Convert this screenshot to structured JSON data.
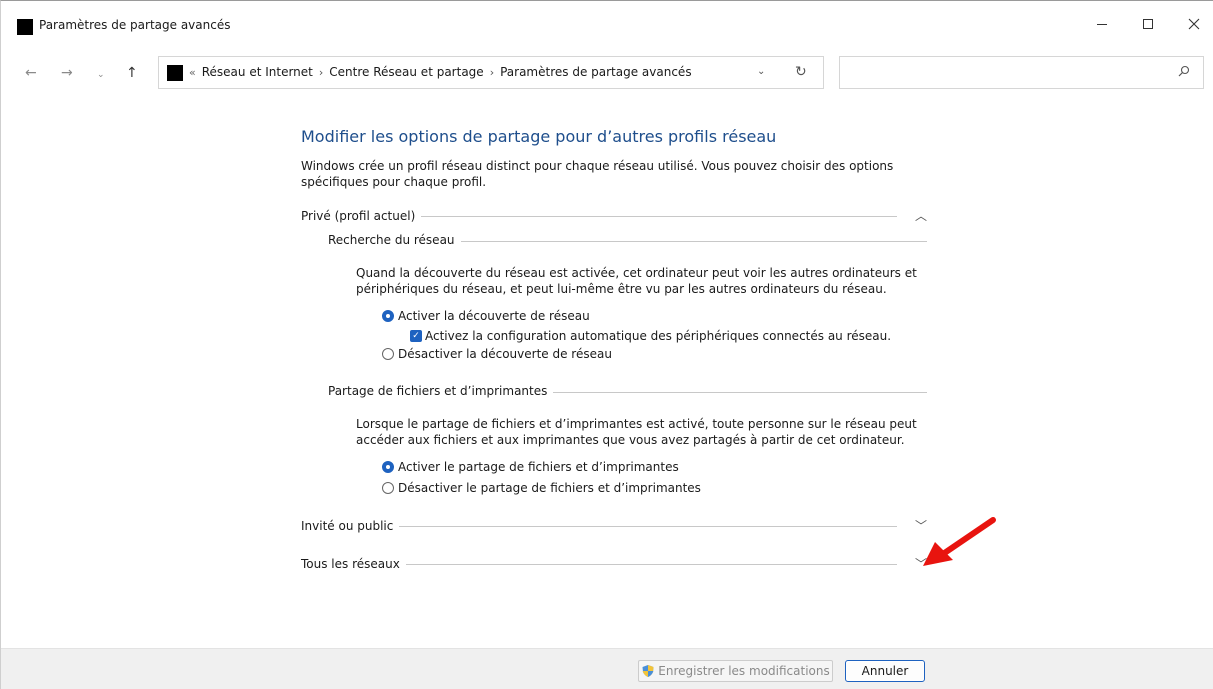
{
  "window": {
    "title": "Paramètres de partage avancés"
  },
  "nav": {
    "overflow_glyph": "«",
    "breadcrumbs": [
      "Réseau et Internet",
      "Centre Réseau et partage",
      "Paramètres de partage avancés"
    ],
    "search_value": ""
  },
  "content": {
    "title": "Modifier les options de partage pour d’autres profils réseau",
    "intro": "Windows crée un profil réseau distinct pour chaque réseau utilisé. Vous pouvez choisir des options spécifiques pour chaque profil.",
    "prive": {
      "label": "Privé (profil actuel)",
      "expanded": true,
      "recherche": {
        "label": "Recherche du réseau",
        "description": "Quand la découverte du réseau est activée, cet ordinateur peut voir les autres ordinateurs et périphériques du réseau, et peut lui-même être vu par les autres ordinateurs du réseau.",
        "option_on": "Activer la découverte de réseau",
        "option_auto": "Activez la configuration automatique des périphériques connectés au réseau.",
        "option_off": "Désactiver la découverte de réseau",
        "selected": "on",
        "auto_checked": true
      },
      "partage": {
        "label": "Partage de fichiers et d’imprimantes",
        "description": "Lorsque le partage de fichiers et d’imprimantes est activé, toute personne sur le réseau peut accéder aux fichiers et aux imprimantes que vous avez partagés à partir de cet ordinateur.",
        "option_on": "Activer le partage de fichiers et d’imprimantes",
        "option_off": "Désactiver le partage de fichiers et d’imprimantes",
        "selected": "on"
      }
    },
    "invite": {
      "label": "Invité ou public",
      "expanded": false
    },
    "tous": {
      "label": "Tous les réseaux",
      "expanded": false
    }
  },
  "footer": {
    "save_label": "Enregistrer les modifications",
    "save_enabled": false,
    "cancel_label": "Annuler"
  },
  "colors": {
    "accent": "#1e62c0",
    "title_blue": "#1e4e8c",
    "annotation_arrow": "#e8140f"
  }
}
